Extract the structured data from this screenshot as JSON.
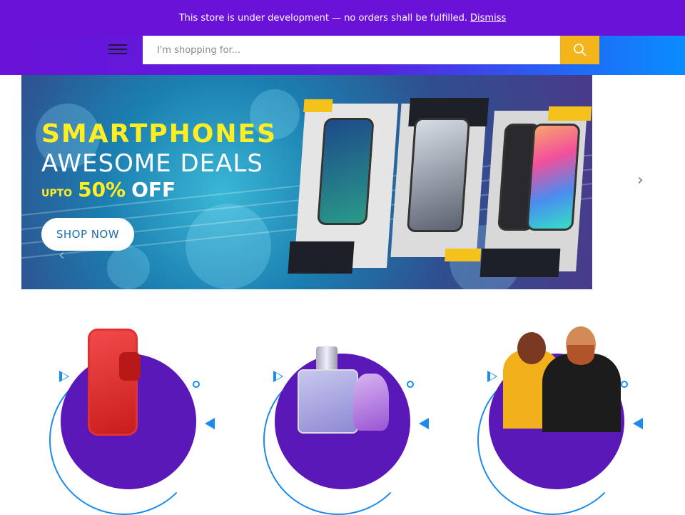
{
  "notice": {
    "text": "This store is under development — no orders shall be fulfilled.",
    "dismiss": "Dismiss"
  },
  "header": {
    "search_placeholder": "I'm shopping for...",
    "menu_icon": "hamburger-icon",
    "search_icon": "search-icon"
  },
  "banner": {
    "title_line1": "SMARTPHONES",
    "title_line2": "AWESOME DEALS",
    "upto": "UPTO",
    "percent": "50%",
    "off": "OFF",
    "cta": "SHOP NOW"
  },
  "colors": {
    "accent": "#6a12d8",
    "search_button": "#f4b51c",
    "highlight": "#ffee22"
  },
  "categories": [
    {
      "icon": "smartphone-image"
    },
    {
      "icon": "perfume-image"
    },
    {
      "icon": "fashion-models-image"
    }
  ]
}
